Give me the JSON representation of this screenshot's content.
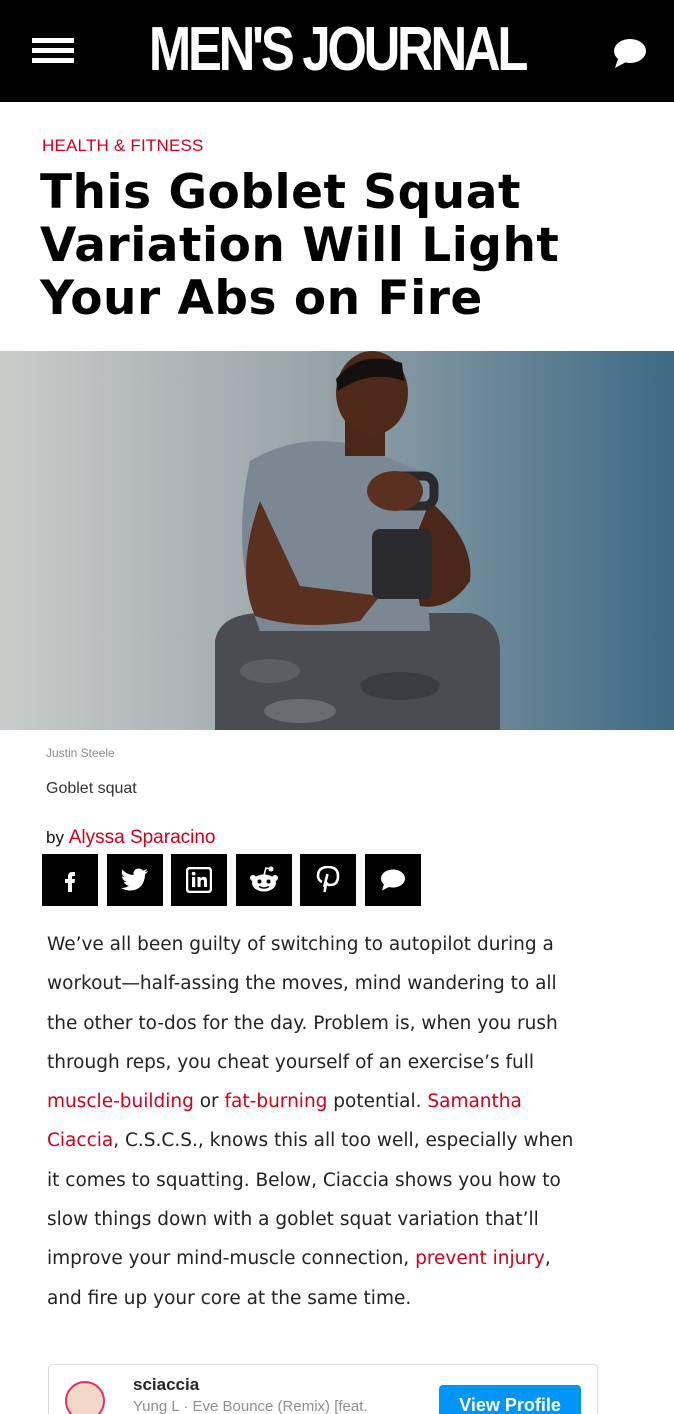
{
  "header": {
    "logo_text": "MEN'S JOURNAL",
    "menu_icon": "hamburger-menu-icon",
    "comment_icon": "speech-bubble-icon",
    "background_color": "#000000"
  },
  "article": {
    "category": "HEALTH & FITNESS",
    "headline": "This Goblet Squat Variation Will Light Your Abs on Fire",
    "image_credit": "Justin Steele",
    "image_caption": "Goblet squat",
    "byline_prefix": "by",
    "author": "Alyssa Sparacino",
    "accent_color": "#d2001c"
  },
  "share_buttons": [
    {
      "icon": "facebook-icon"
    },
    {
      "icon": "twitter-icon"
    },
    {
      "icon": "linkedin-icon"
    },
    {
      "icon": "reddit-icon"
    },
    {
      "icon": "pinterest-icon"
    },
    {
      "icon": "comment-icon"
    }
  ],
  "body": {
    "l1": "We’ve all been guilty of switching to autopilot during a",
    "l2": "workout—half-assing the moves, mind wandering to all",
    "l3": "the other to-dos for the day. Problem is, when you rush",
    "l4": "through reps, you cheat yourself of an exercise’s full",
    "link_muscle": "muscle-building",
    "t_or": " or ",
    "link_fat": "fat-burning",
    "t_potential": " potential. ",
    "link_samantha": "Samantha",
    "link_ciaccia": "Ciaccia",
    "t_cscs": ", C.S.C.S., knows this all too well, especially when",
    "l7": "it comes to squatting. Below, Ciaccia shows you how to",
    "l8": "slow things down with a goblet squat variation that’ll",
    "t_improve": "improve your mind-muscle connection, ",
    "link_injury": "prevent injury",
    "t_comma": ",",
    "l10": "and fire up your core at the same time."
  },
  "instagram_embed": {
    "username": "sciaccia",
    "subtitle": "Yung L · Eve Bounce (Remix) [feat.",
    "button_label": "View Profile",
    "button_color": "#0095f6"
  }
}
